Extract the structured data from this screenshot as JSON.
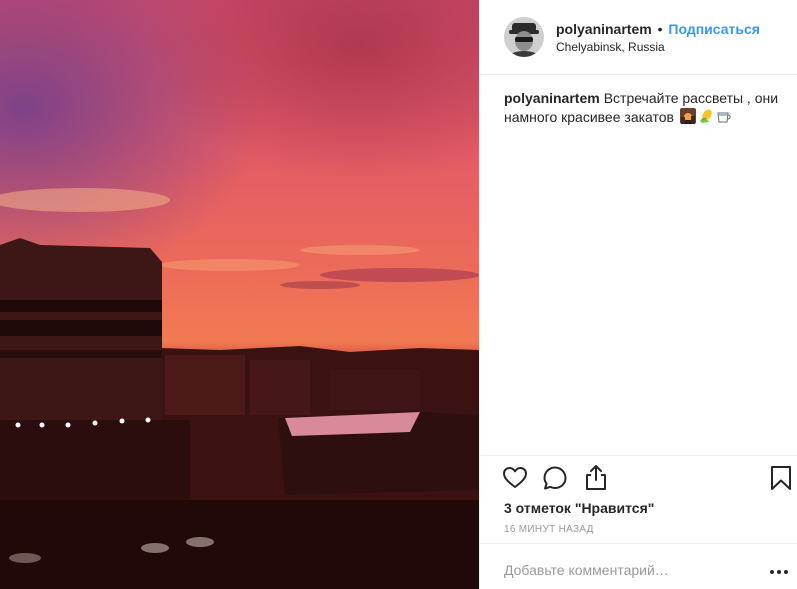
{
  "post": {
    "username": "polyaninartem",
    "separator": "•",
    "follow_label": "Подписаться",
    "location": "Chelyabinsk, Russia"
  },
  "caption": {
    "username": "polyaninartem",
    "text": "Встречайте рассветы , они намного красивее закатов",
    "emojis": [
      "sunrise-over-city-emoji",
      "corn-emoji",
      "hot-beverage-emoji"
    ]
  },
  "stats": {
    "likes_text": "3 отметок \"Нравится\"",
    "time_text": "16 МИНУТ НАЗАД"
  },
  "comment": {
    "placeholder": "Добавьте комментарий…"
  },
  "icons": {
    "like": "heart-icon",
    "comment": "comment-bubble-icon",
    "share": "share-icon",
    "save": "bookmark-icon",
    "more": "more-options-icon"
  },
  "colors": {
    "link": "#3897f0",
    "text": "#262626",
    "muted": "#999999",
    "divider": "#efefef"
  }
}
